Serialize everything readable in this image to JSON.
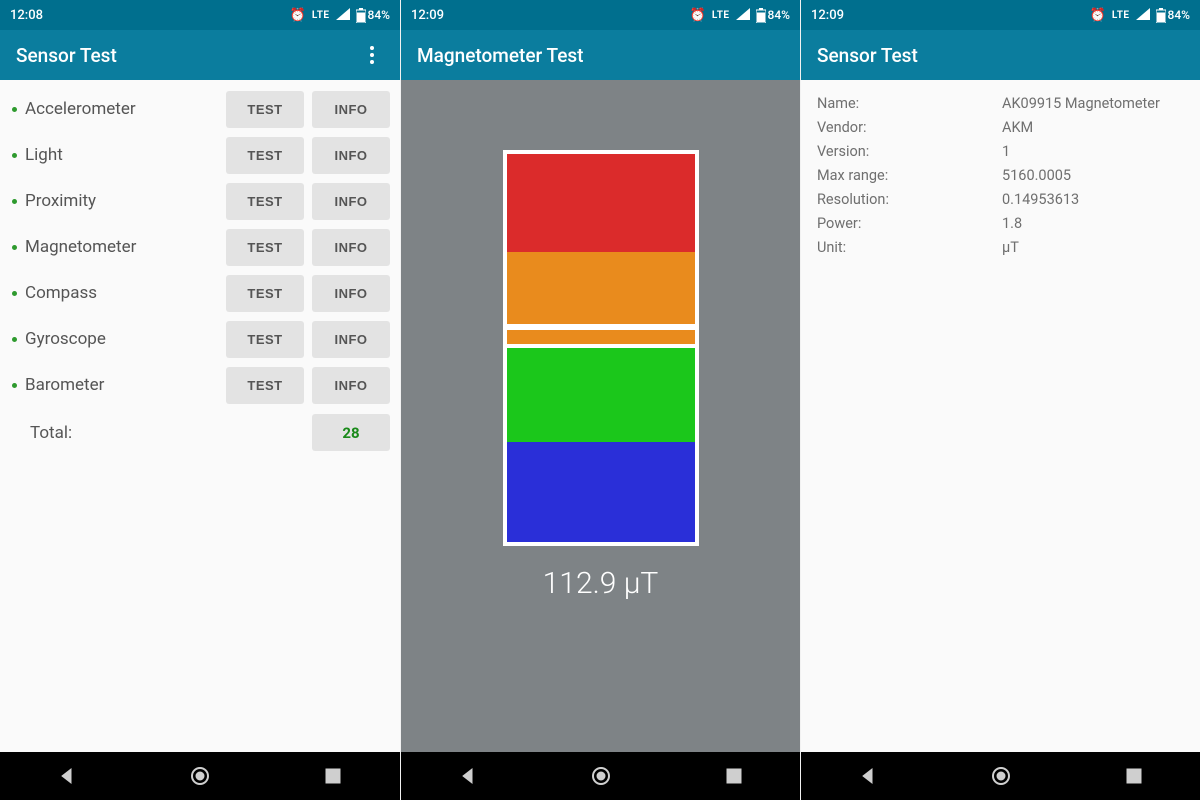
{
  "screens": [
    {
      "status": {
        "time": "12:08",
        "lte": "LTE",
        "battery": "84%"
      },
      "appbar": {
        "title": "Sensor Test",
        "has_overflow": true
      },
      "sensors": [
        {
          "label": "Accelerometer",
          "test": "TEST",
          "info": "INFO"
        },
        {
          "label": "Light",
          "test": "TEST",
          "info": "INFO"
        },
        {
          "label": "Proximity",
          "test": "TEST",
          "info": "INFO"
        },
        {
          "label": "Magnetometer",
          "test": "TEST",
          "info": "INFO"
        },
        {
          "label": "Compass",
          "test": "TEST",
          "info": "INFO"
        },
        {
          "label": "Gyroscope",
          "test": "TEST",
          "info": "INFO"
        },
        {
          "label": "Barometer",
          "test": "TEST",
          "info": "INFO"
        }
      ],
      "total_label": "Total:",
      "total_value": "28"
    },
    {
      "status": {
        "time": "12:09",
        "lte": "LTE",
        "battery": "84%"
      },
      "appbar": {
        "title": "Magnetometer Test",
        "has_overflow": false
      },
      "reading": "112.9 µT",
      "gauge_colors": {
        "red": "#db2b2b",
        "orange": "#e98b1d",
        "green": "#1bc71b",
        "blue": "#2a2fd8"
      }
    },
    {
      "status": {
        "time": "12:09",
        "lte": "LTE",
        "battery": "84%"
      },
      "appbar": {
        "title": "Sensor Test",
        "has_overflow": false
      },
      "info": [
        {
          "k": "Name:",
          "v": "AK09915 Magnetometer"
        },
        {
          "k": "Vendor:",
          "v": "AKM"
        },
        {
          "k": "Version:",
          "v": "1"
        },
        {
          "k": "Max range:",
          "v": "5160.0005"
        },
        {
          "k": "Resolution:",
          "v": "0.14953613"
        },
        {
          "k": "Power:",
          "v": "1.8"
        },
        {
          "k": "Unit:",
          "v": "µT"
        }
      ]
    }
  ]
}
